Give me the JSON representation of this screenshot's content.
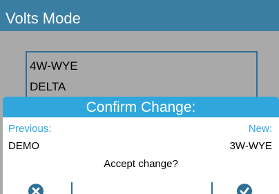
{
  "header": {
    "title": "Volts Mode"
  },
  "list": {
    "items": [
      "4W-WYE",
      "DELTA"
    ]
  },
  "dialog": {
    "title": "Confirm Change:",
    "previous_label": "Previous:",
    "new_label": "New:",
    "previous_value": "DEMO",
    "new_value": "3W-WYE",
    "prompt": "Accept change?"
  },
  "softkeys": {
    "cancel_icon": "x-circle-icon",
    "accept_icon": "check-circle-icon"
  },
  "colors": {
    "header": "#3a7ea3",
    "dialog_title": "#2fa7dc",
    "accent": "#2e6f95",
    "background": "#a9a9a9"
  }
}
